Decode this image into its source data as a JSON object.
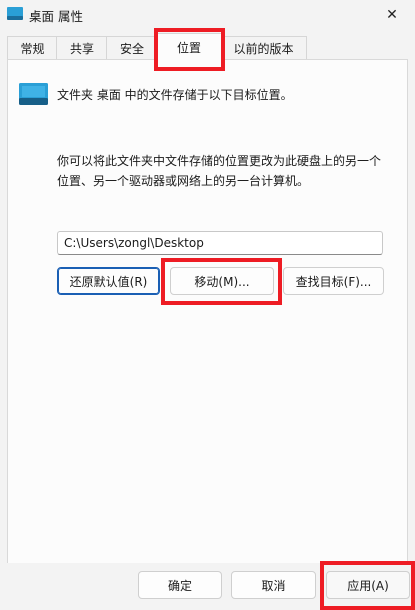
{
  "window": {
    "title": "桌面 属性",
    "title_icon": "folder-icon",
    "close_glyph": "✕"
  },
  "tabs": [
    {
      "label": "常规",
      "active": false
    },
    {
      "label": "共享",
      "active": false
    },
    {
      "label": "安全",
      "active": false
    },
    {
      "label": "位置",
      "active": true
    },
    {
      "label": "以前的版本",
      "active": false
    }
  ],
  "location": {
    "description": "文件夹 桌面 中的文件存储于以下目标位置。",
    "paragraph": "你可以将此文件夹中文件存储的位置更改为此硬盘上的另一个位置、另一个驱动器或网络上的另一台计算机。",
    "path_value": "C:\\Users\\zongl\\Desktop",
    "restore_default_label": "还原默认值(R)",
    "move_label": "移动(M)...",
    "find_target_label": "查找目标(F)..."
  },
  "footer": {
    "ok_label": "确定",
    "cancel_label": "取消",
    "apply_label": "应用(A)"
  },
  "colors": {
    "highlight": "#ee1c24",
    "focus": "#1a5fb4",
    "folder_icon": "#2a9fd6"
  }
}
